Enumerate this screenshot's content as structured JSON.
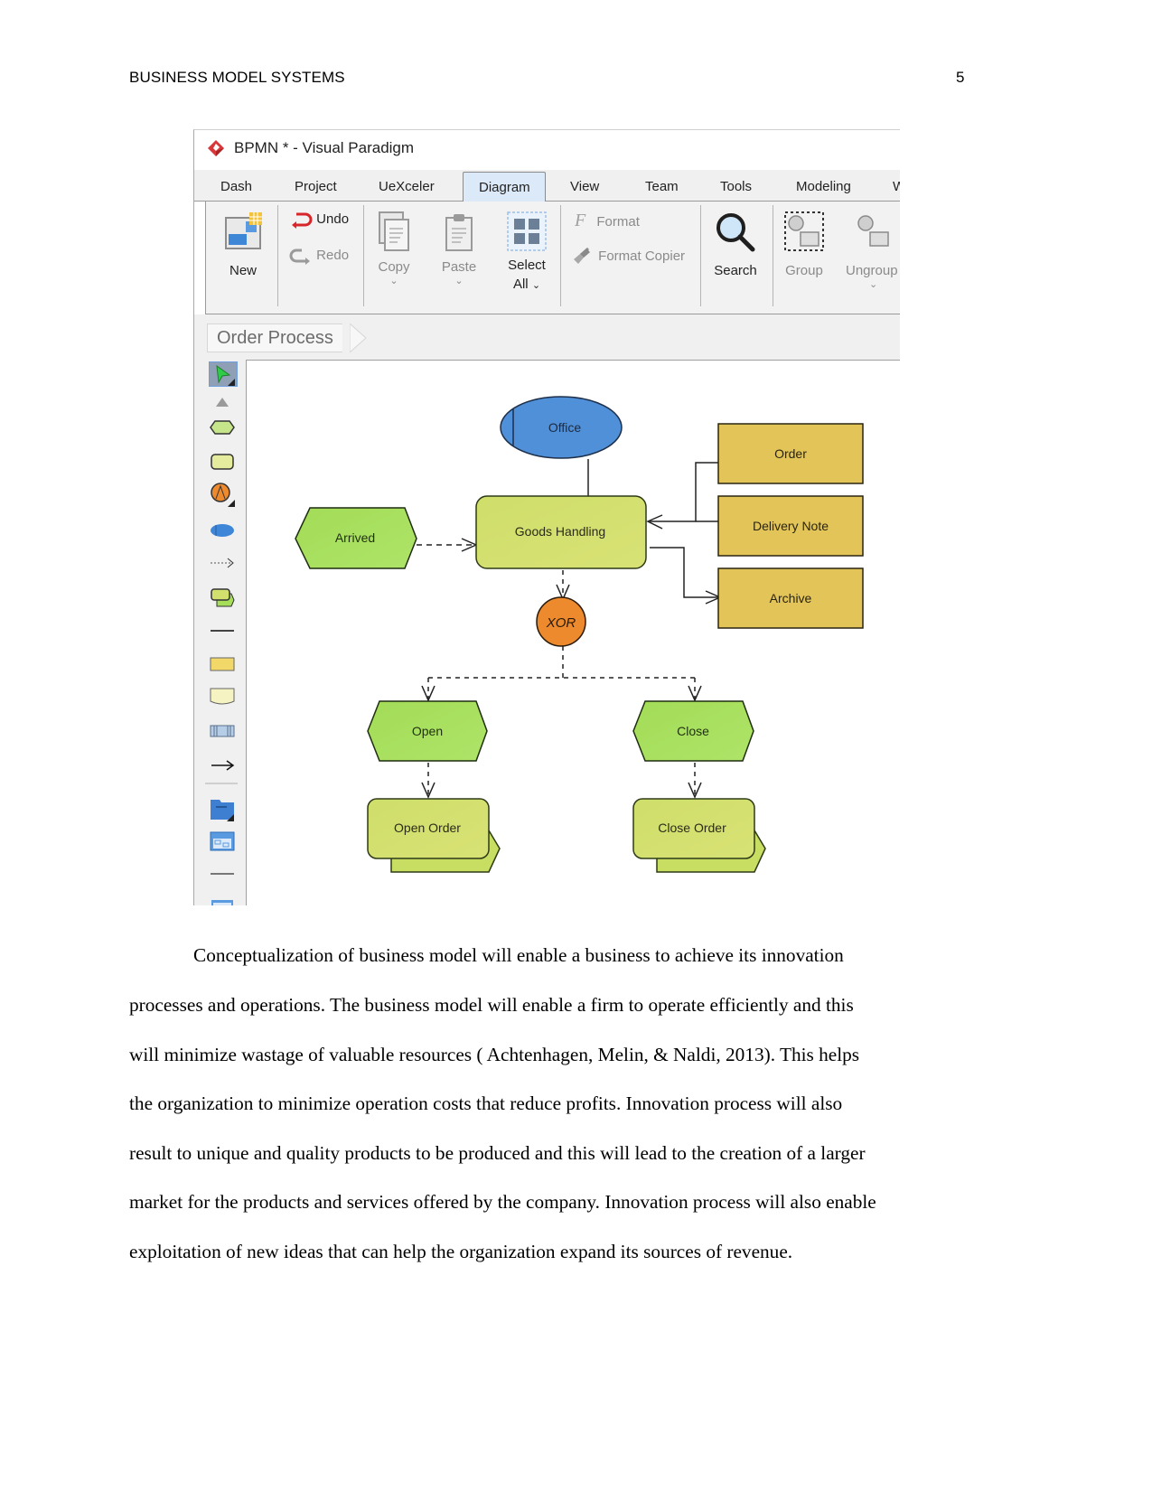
{
  "document": {
    "running_head": "BUSINESS MODEL SYSTEMS",
    "page_number": "5",
    "paragraph_lines": [
      "Conceptualization of business model will enable a business to achieve its innovation",
      "processes and operations. The business model will enable a firm to operate efficiently and this",
      "will minimize wastage of valuable resources ( Achtenhagen, Melin, & Naldi, 2013). This helps",
      "the organization to minimize operation costs that reduce profits. Innovation process will also",
      "result to unique and quality products to be produced and this will lead to the creation of a larger",
      "market for the products and services offered by the company. Innovation process will also enable",
      "exploitation of new ideas that can help the organization expand its sources of revenue."
    ]
  },
  "app": {
    "window_title": "BPMN * - Visual Paradigm",
    "menu_tabs": [
      {
        "label": "Dash"
      },
      {
        "label": "Project"
      },
      {
        "label": "UeXceler"
      },
      {
        "label": "Diagram",
        "active": true
      },
      {
        "label": "View"
      },
      {
        "label": "Team"
      },
      {
        "label": "Tools"
      },
      {
        "label": "Modeling"
      },
      {
        "label": "W"
      }
    ],
    "ribbon": {
      "new": "New",
      "undo": "Undo",
      "redo": "Redo",
      "copy": "Copy",
      "paste": "Paste",
      "select_all_line1": "Select",
      "select_all_line2": "All",
      "format": "Format",
      "format_copier": "Format Copier",
      "search": "Search",
      "group": "Group",
      "ungroup": "Ungroup"
    },
    "breadcrumb": "Order Process",
    "palette_icons": [
      "selector-icon",
      "collapse-arrow-icon",
      "event-hexagon-icon",
      "function-rect-icon",
      "xor-connector-icon",
      "organization-unit-icon",
      "control-flow-icon",
      "process-path-icon",
      "line-icon",
      "information-object-icon",
      "document-icon",
      "application-system-icon",
      "arrow-icon",
      "divider",
      "package-icon",
      "subdiagram-icon",
      "divider",
      "table-icon"
    ],
    "colors": {
      "event_fill": "#a6de5a",
      "function_fill": "#d2e06e",
      "info_fill": "#e2c459",
      "org_fill": "#4f90d8",
      "xor_fill": "#ec8a2d",
      "accent_tab": "#dbe9f8"
    }
  },
  "diagram": {
    "nodes": {
      "office": "Office",
      "goods_handling": "Goods Handling",
      "arrived": "Arrived",
      "order": "Order",
      "delivery_note": "Delivery Note",
      "archive": "Archive",
      "xor": "XOR",
      "open": "Open",
      "close": "Close",
      "open_order": "Open Order",
      "close_order": "Close Order"
    }
  }
}
